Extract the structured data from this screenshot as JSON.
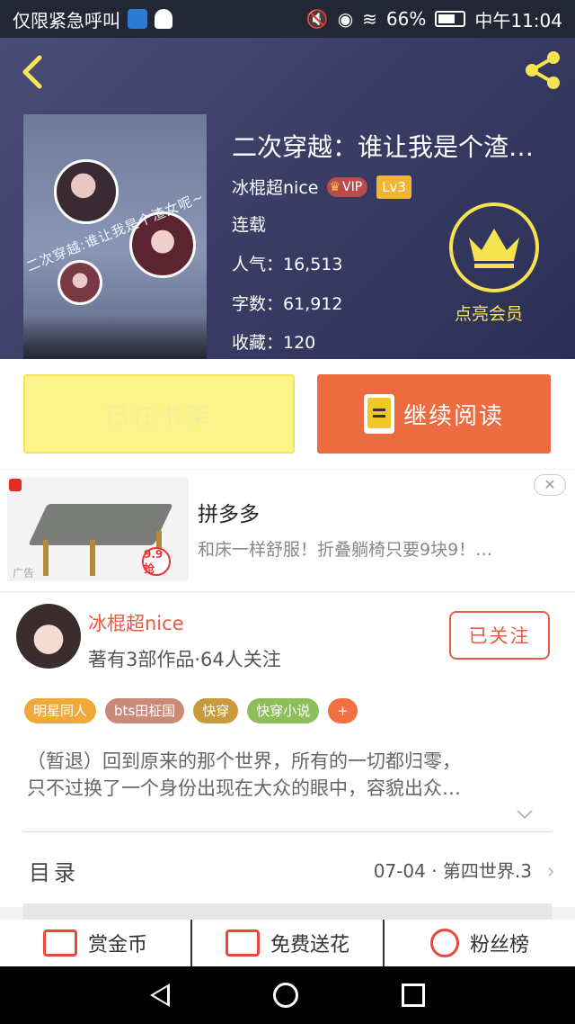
{
  "status_bar": {
    "left_text": "仅限紧急呼叫",
    "battery": "66%",
    "time": "中午11:04",
    "battery_level": 0.66
  },
  "book": {
    "title": "二次穿越：谁让我是个渣…",
    "author": "冰棍超nice",
    "vip_label": "VIP",
    "level": "Lv3",
    "status": "连载",
    "popularity": "人气：16,513",
    "word_count": "字数：61,912",
    "favorites": "收藏：120",
    "cover_title": "二次穿越:谁让我是个渣女呢~"
  },
  "vip_promo": {
    "label": "点亮会员"
  },
  "actions": {
    "shelf_label": "已在书架",
    "read_label": "继续阅读"
  },
  "ad": {
    "title": "拼多多",
    "description": "和床一样舒服！折叠躺椅只要9块9！…",
    "tag": "广告",
    "price_text": "9.9抢",
    "close": "✕"
  },
  "author_section": {
    "name": "冰棍超nice",
    "meta": "著有3部作品·64人关注",
    "follow_label": "已关注"
  },
  "tags": [
    {
      "label": "明星同人",
      "color": "#f0a83a"
    },
    {
      "label": "bts田柾国",
      "color": "#c98a78"
    },
    {
      "label": "快穿",
      "color": "#c99a3a"
    },
    {
      "label": "快穿小说",
      "color": "#8cbf5a"
    },
    {
      "label": "+",
      "color": "#f07040"
    }
  ],
  "description": {
    "line1": "（暂退）回到原来的那个世界，所有的一切都归零，",
    "line2": "只不过换了一个身份出现在大众的眼中，容貌出众…"
  },
  "toc": {
    "label": "目录",
    "latest": "07-04 · 第四世界.3"
  },
  "features": [
    {
      "label": "赏金币",
      "icon": "envelope-icon"
    },
    {
      "label": "免费送花",
      "icon": "flower-icon"
    },
    {
      "label": "粉丝榜",
      "icon": "target-icon"
    }
  ],
  "colors": {
    "accent_orange": "#ed6b40",
    "shelf_yellow": "#fbf48a",
    "vip_yellow": "#f5e34f",
    "author_red": "#e85a42"
  }
}
